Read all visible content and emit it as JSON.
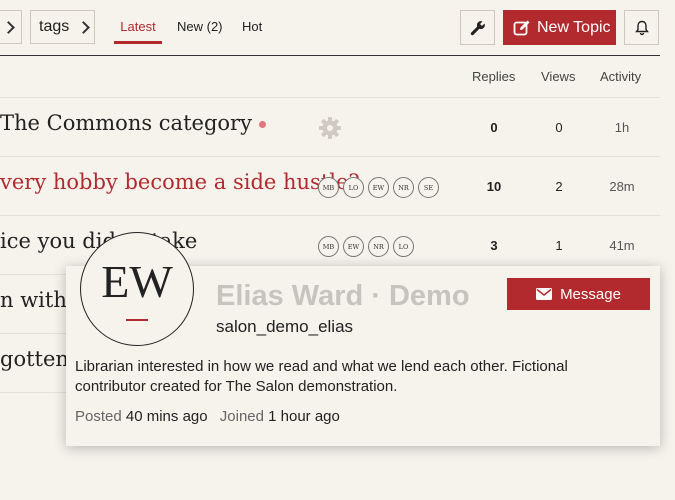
{
  "nav": {
    "tags_label": "tags",
    "tabs": [
      {
        "label": "Latest",
        "active": true
      },
      {
        "label": "New (2)"
      },
      {
        "label": "Hot"
      }
    ],
    "new_topic_label": "New Topic"
  },
  "table": {
    "headers": {
      "replies": "Replies",
      "views": "Views",
      "activity": "Activity"
    },
    "rows": [
      {
        "title": "The Commons category",
        "posters": [],
        "replies": "0",
        "views": "0",
        "activity": "1h"
      },
      {
        "title": "very hobby become a side hustle?",
        "posters": [
          "MB",
          "LO",
          "EW",
          "NR",
          "SE"
        ],
        "replies": "10",
        "views": "2",
        "activity": "28m"
      },
      {
        "title": "ice you didn’t take",
        "posters": [
          "MB",
          "EW",
          "NR",
          "LO"
        ],
        "replies": "3",
        "views": "1",
        "activity": "41m"
      },
      {
        "title": "n with",
        "posters": [],
        "replies": "",
        "views": "",
        "activity": ""
      },
      {
        "title": "gotten b",
        "posters": [],
        "replies": "",
        "views": "",
        "activity": ""
      }
    ]
  },
  "user_card": {
    "avatar_initials": "EW",
    "name": "Elias Ward · Demo",
    "username": "salon_demo_elias",
    "message_label": "Message",
    "bio": "Librarian interested in how we read and what we lend each other. Fictional contributor created for The Salon demonstration.",
    "posted_label": "Posted",
    "posted_value": "40 mins ago",
    "joined_label": "Joined",
    "joined_value": "1 hour ago"
  },
  "colors": {
    "accent": "#b22a2e",
    "background": "#f6f2ec"
  }
}
